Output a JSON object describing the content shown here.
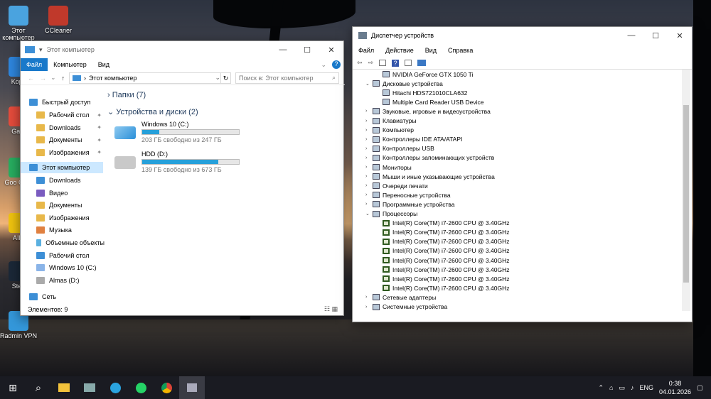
{
  "desktop": {
    "icons": [
      {
        "label": "Этот компьютер",
        "color": "#4aa3df"
      },
      {
        "label": "CCleaner",
        "color": "#c0392b"
      },
      {
        "label": "Kops",
        "color": "#2e86de"
      },
      {
        "label": "Gam",
        "color": "#e74c3c"
      },
      {
        "label": "Goo Chro",
        "color": "#27ae60"
      },
      {
        "label": "AIM",
        "color": "#f1c40f"
      },
      {
        "label": "Stea",
        "color": "#1b2838"
      },
      {
        "label": "Radmin VPN",
        "color": "#3498db"
      }
    ]
  },
  "explorer": {
    "title": "Этот компьютер",
    "menu": [
      "Файл",
      "Компьютер",
      "Вид"
    ],
    "address": "Этот компьютер",
    "search_placeholder": "Поиск в: Этот компьютер",
    "sections": {
      "folders": "Папки (7)",
      "drives": "Устройства и диски (2)"
    },
    "quick_access": "Быстрый доступ",
    "nav_quick": [
      "Рабочий стол",
      "Downloads",
      "Документы",
      "Изображения"
    ],
    "this_pc": "Этот компьютер",
    "nav_pc": [
      "Downloads",
      "Видео",
      "Документы",
      "Изображения",
      "Музыка",
      "Объемные объекты",
      "Рабочий стол",
      "Windows 10 (C:)",
      "Almas  (D:)"
    ],
    "network": "Сеть",
    "drives": [
      {
        "name": "Windows 10 (C:)",
        "info": "203 ГБ свободно из 247 ГБ",
        "used": 0.18
      },
      {
        "name": "HDD (D:)",
        "info": "139 ГБ свободно из 673 ГБ",
        "used": 0.79
      }
    ],
    "status": "Элементов: 9"
  },
  "devmgr": {
    "title": "Диспетчер устройств",
    "menu": [
      "Файл",
      "Действие",
      "Вид",
      "Справка"
    ],
    "rows": [
      {
        "level": 2,
        "text": "NVIDIA GeForce GTX 1050 Ti",
        "arrow": ""
      },
      {
        "level": 1,
        "text": "Дисковые устройства",
        "arrow": "⌄"
      },
      {
        "level": 2,
        "text": "Hitachi HDS721010CLA632",
        "arrow": ""
      },
      {
        "level": 2,
        "text": "Multiple Card  Reader USB Device",
        "arrow": ""
      },
      {
        "level": 1,
        "text": "Звуковые, игровые и видеоустройства",
        "arrow": "›"
      },
      {
        "level": 1,
        "text": "Клавиатуры",
        "arrow": "›"
      },
      {
        "level": 1,
        "text": "Компьютер",
        "arrow": "›"
      },
      {
        "level": 1,
        "text": "Контроллеры IDE ATA/ATAPI",
        "arrow": "›"
      },
      {
        "level": 1,
        "text": "Контроллеры USB",
        "arrow": "›"
      },
      {
        "level": 1,
        "text": "Контроллеры запоминающих устройств",
        "arrow": "›"
      },
      {
        "level": 1,
        "text": "Мониторы",
        "arrow": "›"
      },
      {
        "level": 1,
        "text": "Мыши и иные указывающие устройства",
        "arrow": "›"
      },
      {
        "level": 1,
        "text": "Очереди печати",
        "arrow": "›"
      },
      {
        "level": 1,
        "text": "Переносные устройства",
        "arrow": "›"
      },
      {
        "level": 1,
        "text": "Программные устройства",
        "arrow": "›"
      },
      {
        "level": 1,
        "text": "Процессоры",
        "arrow": "⌄"
      },
      {
        "level": 2,
        "text": "Intel(R) Core(TM) i7-2600 CPU @ 3.40GHz",
        "arrow": "",
        "cpu": true
      },
      {
        "level": 2,
        "text": "Intel(R) Core(TM) i7-2600 CPU @ 3.40GHz",
        "arrow": "",
        "cpu": true
      },
      {
        "level": 2,
        "text": "Intel(R) Core(TM) i7-2600 CPU @ 3.40GHz",
        "arrow": "",
        "cpu": true
      },
      {
        "level": 2,
        "text": "Intel(R) Core(TM) i7-2600 CPU @ 3.40GHz",
        "arrow": "",
        "cpu": true
      },
      {
        "level": 2,
        "text": "Intel(R) Core(TM) i7-2600 CPU @ 3.40GHz",
        "arrow": "",
        "cpu": true
      },
      {
        "level": 2,
        "text": "Intel(R) Core(TM) i7-2600 CPU @ 3.40GHz",
        "arrow": "",
        "cpu": true
      },
      {
        "level": 2,
        "text": "Intel(R) Core(TM) i7-2600 CPU @ 3.40GHz",
        "arrow": "",
        "cpu": true
      },
      {
        "level": 2,
        "text": "Intel(R) Core(TM) i7-2600 CPU @ 3.40GHz",
        "arrow": "",
        "cpu": true
      },
      {
        "level": 1,
        "text": "Сетевые адаптеры",
        "arrow": "›"
      },
      {
        "level": 1,
        "text": "Системные устройства",
        "arrow": "›"
      }
    ]
  },
  "taskbar": {
    "lang": "ENG",
    "time": "0:38",
    "date": "04.01.2026"
  }
}
